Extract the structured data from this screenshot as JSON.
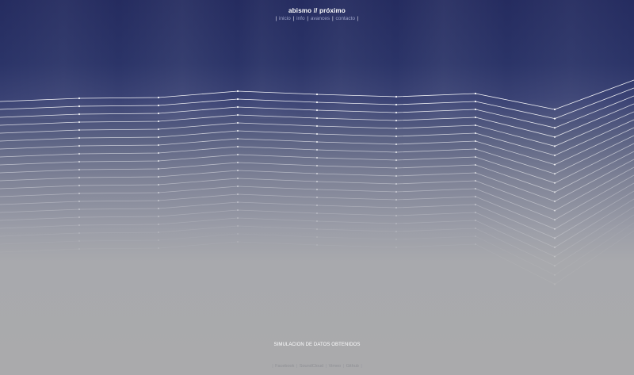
{
  "title": {
    "left": "abismo",
    "sep": "//",
    "right": "próximo"
  },
  "top_nav": {
    "items": [
      {
        "label": "inicio"
      },
      {
        "label": "info"
      },
      {
        "label": "avances"
      },
      {
        "label": "contacto"
      }
    ]
  },
  "caption": "SIMULACION DE DATOS OBTENIDOS",
  "bottom_nav": {
    "items": [
      {
        "label": "Facebook"
      },
      {
        "label": "SoundCloud"
      },
      {
        "label": "Vimeo"
      },
      {
        "label": "Github"
      }
    ]
  },
  "colors": {
    "background_top": "#252c60",
    "background_bottom": "#aaaaac",
    "line": "#ffffff"
  }
}
